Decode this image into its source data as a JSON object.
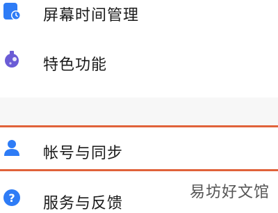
{
  "settings": {
    "items": [
      {
        "label": "屏幕时间管理",
        "icon": "screen-time-icon"
      },
      {
        "label": "特色功能",
        "icon": "flask-icon"
      },
      {
        "label": "帐号与同步",
        "icon": "account-icon"
      },
      {
        "label": "服务与反馈",
        "icon": "help-icon"
      }
    ],
    "highlight_color": "#e0623a",
    "icon_color": "#2e7cf6",
    "features_icon_color": "#6b5cd6"
  },
  "watermark": {
    "text": "易坊好文馆"
  }
}
